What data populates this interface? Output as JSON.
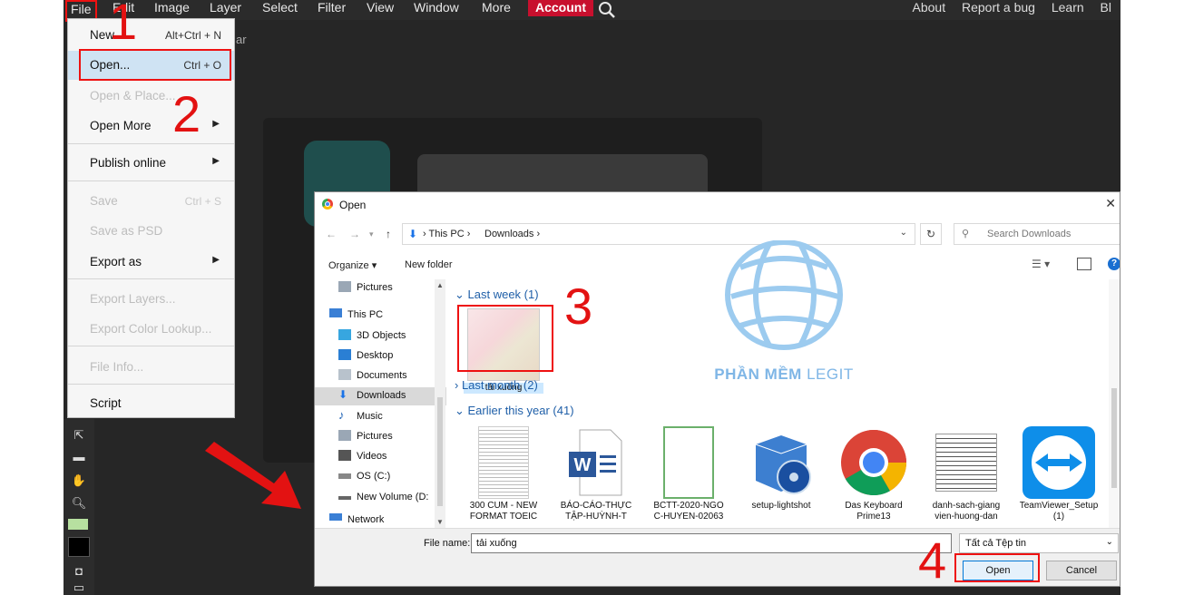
{
  "menubar": {
    "items": [
      "File",
      "Edit",
      "Image",
      "Layer",
      "Select",
      "Filter",
      "View",
      "Window",
      "More",
      "Account"
    ],
    "right_links": [
      "About",
      "Report a bug",
      "Learn",
      "Bl"
    ]
  },
  "file_menu": {
    "new": {
      "label": "New...",
      "shortcut": "Alt+Ctrl + N"
    },
    "open": {
      "label": "Open...",
      "shortcut": "Ctrl + O"
    },
    "open_place": {
      "label": "Open & Place..."
    },
    "open_more": {
      "label": "Open More"
    },
    "publish_online": {
      "label": "Publish online"
    },
    "save": {
      "label": "Save",
      "shortcut": "Ctrl + S"
    },
    "save_psd": {
      "label": "Save as PSD"
    },
    "export_as": {
      "label": "Export as"
    },
    "export_layers": {
      "label": "Export Layers..."
    },
    "export_color_lookup": {
      "label": "Export Color Lookup..."
    },
    "file_info": {
      "label": "File Info..."
    },
    "script": {
      "label": "Script"
    }
  },
  "background": {
    "partial_text": "ar"
  },
  "annotations": {
    "step1": "1",
    "step2": "2",
    "step3": "3",
    "step4": "4"
  },
  "dialog": {
    "title": "Open",
    "close": "✕",
    "address": {
      "this_pc": "This PC",
      "downloads": "Downloads"
    },
    "search_placeholder": "Search Downloads",
    "toolbar": {
      "organize": "Organize ▾",
      "new_folder": "New folder",
      "help": "?"
    },
    "nav_items": [
      "Pictures",
      "This PC",
      "3D Objects",
      "Desktop",
      "Documents",
      "Downloads",
      "Music",
      "Pictures",
      "Videos",
      "OS (C:)",
      "New Volume (D:",
      "Network"
    ],
    "groups": {
      "last_week": "Last week (1)",
      "last_month": "Last month (2)",
      "earlier": "Earlier this year (41)"
    },
    "selected_file": "tải xuống",
    "files": [
      "300 CUM - NEW FORMAT TOEIC",
      "BÁO-CÁO-THỰC TẬP-HUỲNH-T",
      "BCTT-2020-NGO C-HUYEN-02063",
      "setup-lightshot",
      "Das Keyboard Prime13",
      "danh-sach-giang vien-huong-dan",
      "TeamViewer_Setup (1)"
    ],
    "file_name_label": "File name:",
    "file_name_value": "tải xuống",
    "file_type": "Tất cả Tệp tin",
    "open_button": "Open",
    "cancel_button": "Cancel"
  },
  "watermark": {
    "brand": "PHẦN MỀM",
    "suffix": "LEGIT"
  }
}
